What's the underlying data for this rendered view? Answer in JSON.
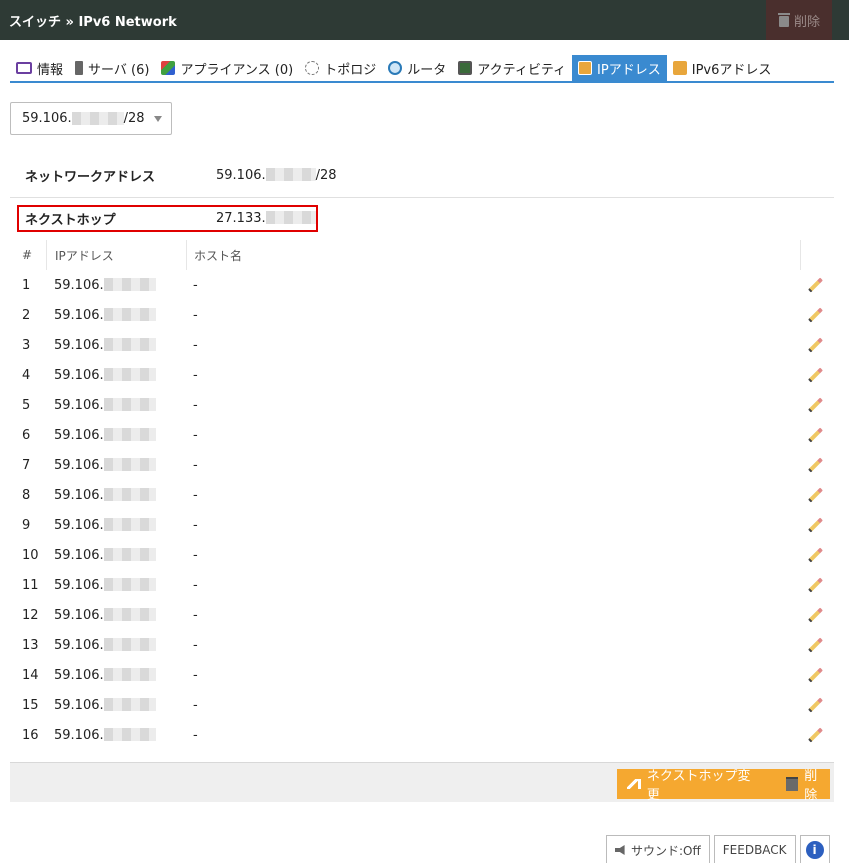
{
  "header": {
    "title": "スイッチ » IPv6 Network",
    "delete_label": "削除"
  },
  "tabs": [
    {
      "label": "情報",
      "icon": "info-card-icon"
    },
    {
      "label": "サーバ (6)",
      "icon": "server-icon"
    },
    {
      "label": "アプライアンス (0)",
      "icon": "appliance-icon"
    },
    {
      "label": "トポロジ",
      "icon": "topology-icon"
    },
    {
      "label": "ルータ",
      "icon": "globe-icon"
    },
    {
      "label": "アクティビティ",
      "icon": "monitor-icon"
    },
    {
      "label": "IPアドレス",
      "icon": "ip-icon",
      "active": true
    },
    {
      "label": "IPv6アドレス",
      "icon": "ipv6-icon"
    }
  ],
  "subnet_select": {
    "prefix": "59.106.",
    "suffix": "/28"
  },
  "network": {
    "network_address_label": "ネットワークアドレス",
    "network_address_prefix": "59.106.",
    "network_address_suffix": "/28",
    "nexthop_label": "ネクストホップ",
    "nexthop_prefix": "27.133."
  },
  "table": {
    "headers": {
      "num": "#",
      "ip": "IPアドレス",
      "host": "ホスト名"
    },
    "rows": [
      {
        "num": "1",
        "ip": "59.106.",
        "host": "-"
      },
      {
        "num": "2",
        "ip": "59.106.",
        "host": "-"
      },
      {
        "num": "3",
        "ip": "59.106.",
        "host": "-"
      },
      {
        "num": "4",
        "ip": "59.106.",
        "host": "-"
      },
      {
        "num": "5",
        "ip": "59.106.",
        "host": "-"
      },
      {
        "num": "6",
        "ip": "59.106.",
        "host": "-"
      },
      {
        "num": "7",
        "ip": "59.106.",
        "host": "-"
      },
      {
        "num": "8",
        "ip": "59.106.",
        "host": "-"
      },
      {
        "num": "9",
        "ip": "59.106.",
        "host": "-"
      },
      {
        "num": "10",
        "ip": "59.106.",
        "host": "-"
      },
      {
        "num": "11",
        "ip": "59.106.",
        "host": "-"
      },
      {
        "num": "12",
        "ip": "59.106.",
        "host": "-"
      },
      {
        "num": "13",
        "ip": "59.106.",
        "host": "-"
      },
      {
        "num": "14",
        "ip": "59.106.",
        "host": "-"
      },
      {
        "num": "15",
        "ip": "59.106.",
        "host": "-"
      },
      {
        "num": "16",
        "ip": "59.106.",
        "host": "-"
      }
    ]
  },
  "footer_actions": {
    "nexthop_change_label": "ネクストホップ変更",
    "delete_label": "削除"
  },
  "bottom": {
    "sound_label": "サウンド:Off",
    "feedback_label": "FEEDBACK",
    "info_label": "i"
  },
  "colors": {
    "topbar": "#2e3a35",
    "tab_active": "#3a8ad0",
    "highlight_box": "#e00000",
    "action_button": "#f5a830",
    "info_icon": "#2c5fbf"
  }
}
